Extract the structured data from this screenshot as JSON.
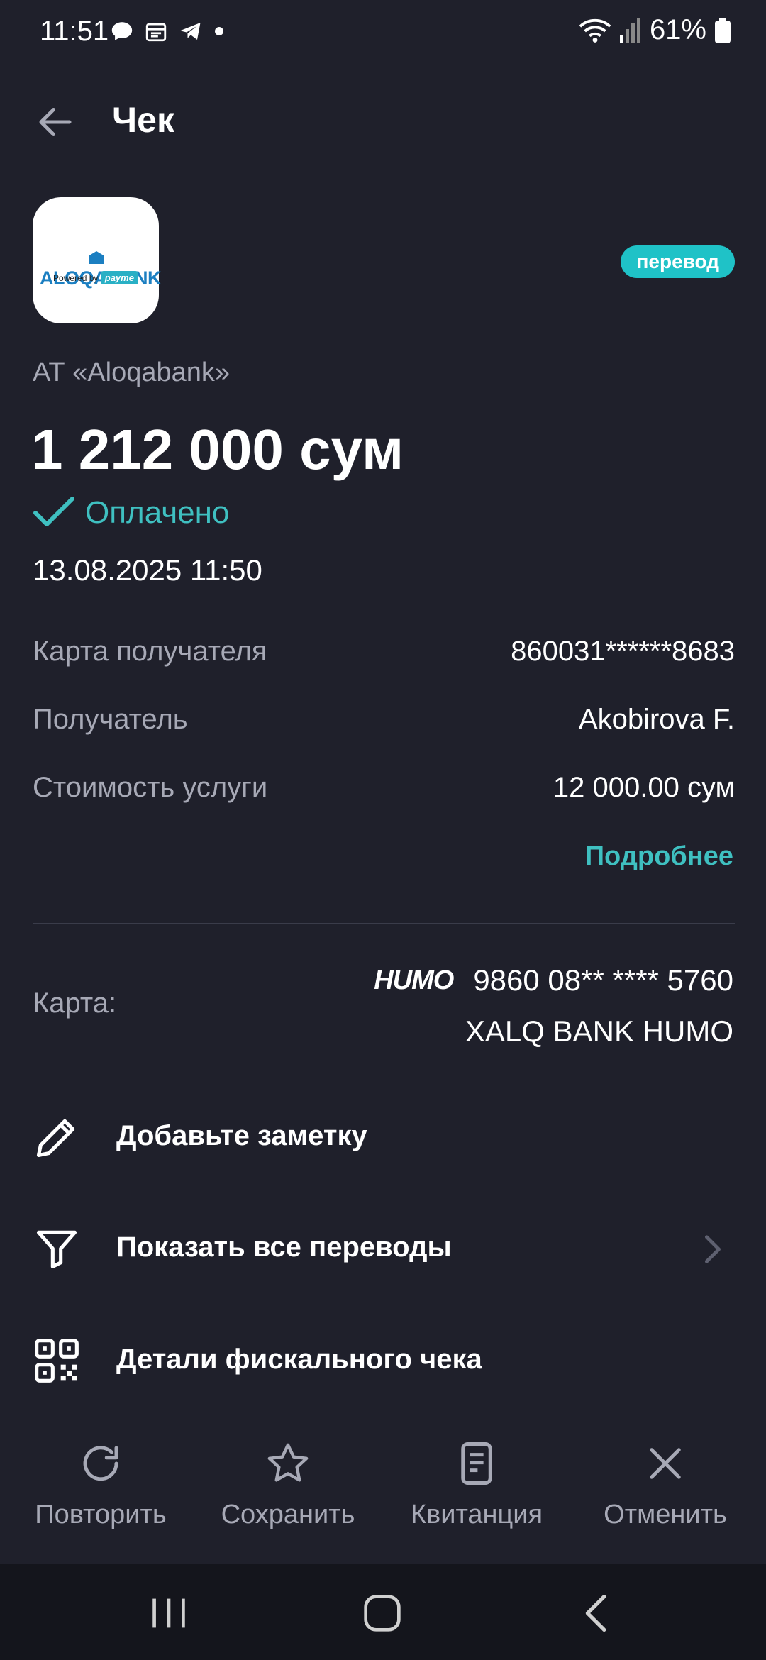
{
  "status_bar": {
    "time": "11:51",
    "battery_pct": "61%",
    "icons_left": [
      "chat-icon",
      "calendar-icon",
      "telegram-icon",
      "dot-icon"
    ],
    "icons_right": [
      "wifi-icon",
      "signal-icon",
      "battery-icon"
    ]
  },
  "header": {
    "title": "Чек",
    "back_icon": "arrow-left-icon"
  },
  "merchant": {
    "logo_text": "ALOQABANK",
    "logo_powered": "Powered by",
    "logo_payme": "payme",
    "badge": "перевод",
    "name": "АТ «Aloqabank»",
    "amount": "1 212 000 сум",
    "status": "Оплачено",
    "datetime": "13.08.2025 11:50"
  },
  "details": [
    {
      "label": "Карта получателя",
      "value": "860031******8683"
    },
    {
      "label": "Получатель",
      "value": "Akobirova F."
    },
    {
      "label": "Стоимость услуги",
      "value": "12 000.00 сум"
    }
  ],
  "more_link": "Подробнее",
  "card": {
    "label": "Карта:",
    "brand": "HUMO",
    "number": "9860 08** **** 5760",
    "bank": "XALQ BANK HUMO"
  },
  "actions": [
    {
      "icon": "pencil-icon",
      "label": "Добавьте заметку"
    },
    {
      "icon": "filter-icon",
      "label": "Показать все переводы"
    },
    {
      "icon": "qr-code-icon",
      "label": "Детали фискального чека"
    }
  ],
  "bottom_actions": [
    {
      "icon": "refresh-icon",
      "label": "Повторить"
    },
    {
      "icon": "star-icon",
      "label": "Сохранить"
    },
    {
      "icon": "receipt-icon",
      "label": "Квитанция"
    },
    {
      "icon": "close-icon",
      "label": "Отменить"
    }
  ],
  "colors": {
    "background": "#1f202b",
    "accent": "#3fc0c1",
    "badge": "#1fc2c7",
    "muted_text": "#a7a9b6",
    "nav_bar": "#14151c"
  }
}
